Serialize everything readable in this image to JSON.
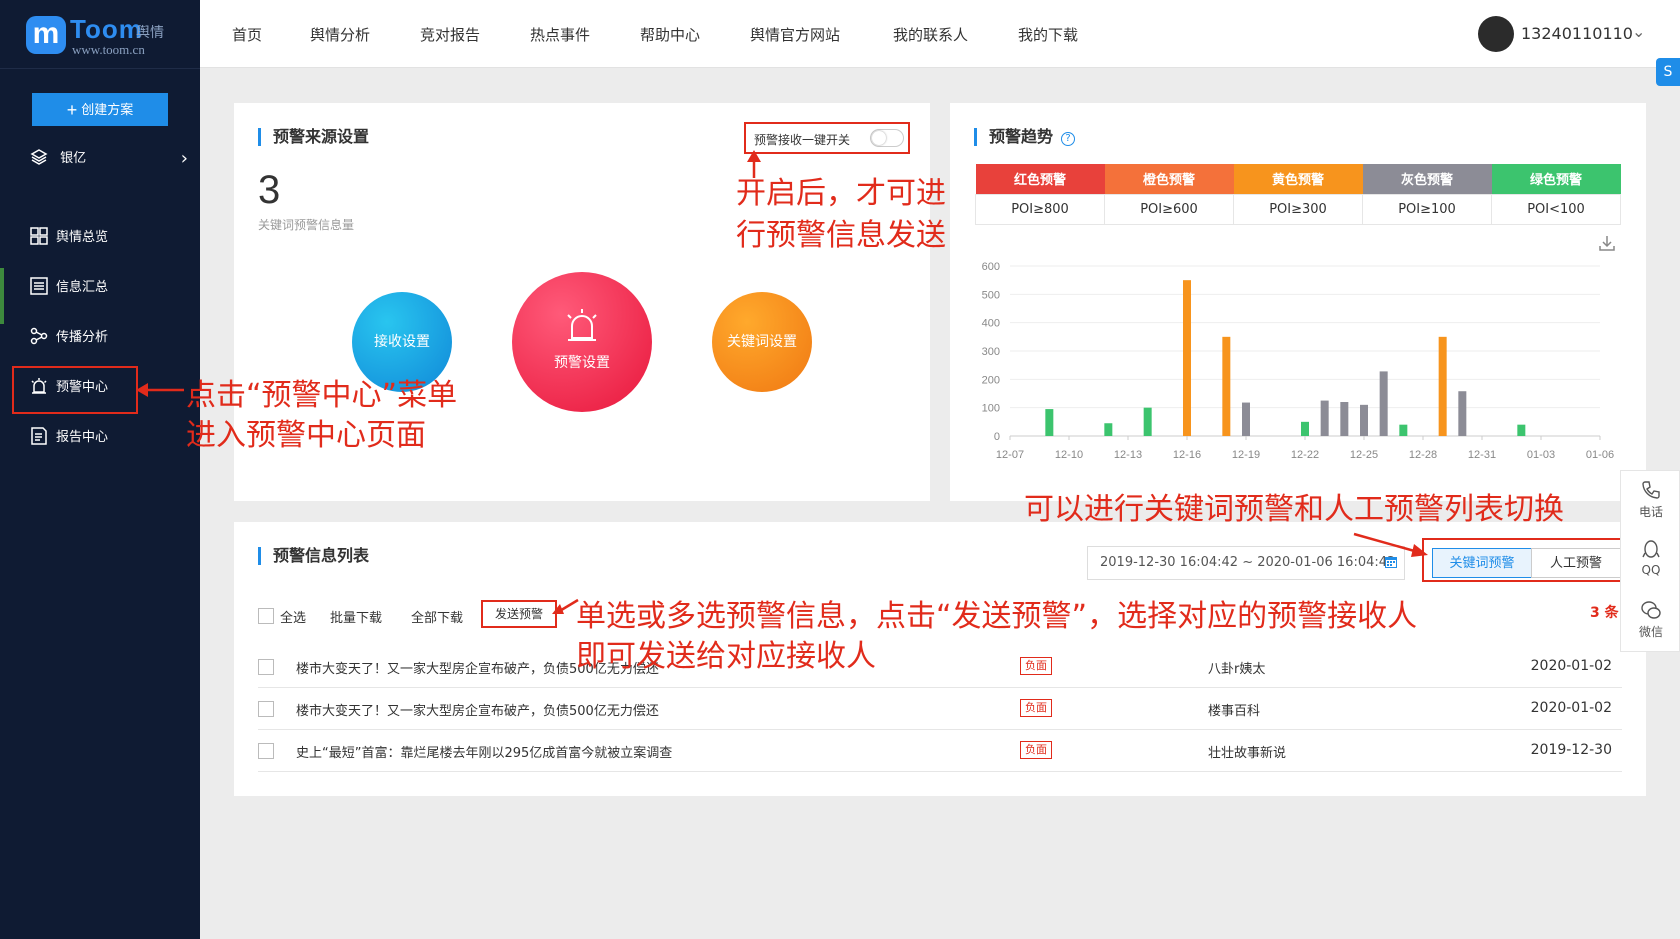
{
  "brand": {
    "name": "Toom",
    "sub": "舆情",
    "url": "www.toom.cn"
  },
  "sidebar": {
    "create_label": "创建方案",
    "org": "银亿",
    "items": [
      {
        "label": "舆情总览"
      },
      {
        "label": "信息汇总"
      },
      {
        "label": "传播分析"
      },
      {
        "label": "预警中心"
      },
      {
        "label": "报告中心"
      }
    ]
  },
  "topnav": {
    "items": [
      "首页",
      "舆情分析",
      "竞对报告",
      "热点事件",
      "帮助中心",
      "舆情官方网站",
      "我的联系人",
      "我的下载"
    ],
    "user_phone": "13240110110"
  },
  "source_card": {
    "title": "预警来源设置",
    "switch_label": "预警接收一键开关",
    "switch_on": false,
    "count": "3",
    "count_label": "关键词预警信息量",
    "btn_receive": "接收设置",
    "btn_alert": "预警设置",
    "btn_keyword": "关键词设置"
  },
  "trend_card": {
    "title": "预警趋势",
    "levels": [
      {
        "name": "红色预警",
        "rule": "POI≥800",
        "color": "#e8413b"
      },
      {
        "name": "橙色预警",
        "rule": "POI≥600",
        "color": "#f4713a"
      },
      {
        "name": "黄色预警",
        "rule": "POI≥300",
        "color": "#f7941d"
      },
      {
        "name": "灰色预警",
        "rule": "POI≥100",
        "color": "#8c8c96"
      },
      {
        "name": "绿色预警",
        "rule": "POI<100",
        "color": "#3cc46e"
      }
    ]
  },
  "chart_data": {
    "type": "bar",
    "ylim": [
      0,
      600
    ],
    "yticks": [
      0,
      100,
      200,
      300,
      400,
      500,
      600
    ],
    "xticks": [
      "12-07",
      "12-10",
      "12-13",
      "12-16",
      "12-19",
      "12-22",
      "12-25",
      "12-28",
      "12-31",
      "01-03",
      "01-06"
    ],
    "bars": [
      {
        "x": "12-09",
        "value": 95,
        "color": "#3cc46e"
      },
      {
        "x": "12-12",
        "value": 45,
        "color": "#3cc46e"
      },
      {
        "x": "12-14",
        "value": 100,
        "color": "#3cc46e"
      },
      {
        "x": "12-16",
        "value": 550,
        "color": "#f7941d"
      },
      {
        "x": "12-18",
        "value": 350,
        "color": "#f7941d"
      },
      {
        "x": "12-19",
        "value": 118,
        "color": "#8c8c96"
      },
      {
        "x": "12-22",
        "value": 50,
        "color": "#3cc46e"
      },
      {
        "x": "12-23",
        "value": 125,
        "color": "#8c8c96"
      },
      {
        "x": "12-24",
        "value": 120,
        "color": "#8c8c96"
      },
      {
        "x": "12-25",
        "value": 110,
        "color": "#8c8c96"
      },
      {
        "x": "12-26",
        "value": 228,
        "color": "#8c8c96"
      },
      {
        "x": "12-27",
        "value": 40,
        "color": "#3cc46e"
      },
      {
        "x": "12-29",
        "value": 350,
        "color": "#f7941d"
      },
      {
        "x": "12-30",
        "value": 158,
        "color": "#8c8c96"
      },
      {
        "x": "01-02",
        "value": 40,
        "color": "#3cc46e"
      }
    ]
  },
  "list_card": {
    "title": "预警信息列表",
    "date_range": "2019-12-30 16:04:42 ~ 2020-01-06 16:04:42",
    "tab_keyword": "关键词预警",
    "tab_manual": "人工预警",
    "count": "3 条",
    "toolbar": {
      "select_all": "全选",
      "batch_download": "批量下载",
      "all_download": "全部下载",
      "send": "发送预警"
    },
    "rows": [
      {
        "title": "楼市大变天了！又一家大型房企宣布破产，负债500亿无力偿还",
        "tag": "负面",
        "source": "八卦r姨太",
        "date": "2020-01-02"
      },
      {
        "title": "楼市大变天了！又一家大型房企宣布破产，负债500亿无力偿还",
        "tag": "负面",
        "source": "楼事百科",
        "date": "2020-01-02"
      },
      {
        "title": "史上“最短”首富：靠烂尾楼去年刚以295亿成首富今就被立案调查",
        "tag": "负面",
        "source": "壮壮故事新说",
        "date": "2019-12-30"
      }
    ]
  },
  "float_panel": {
    "phone": "电话",
    "qq": "QQ",
    "wechat": "微信"
  },
  "annotations": {
    "menu_1": "点击“预警中心”菜单",
    "menu_2": "进入预警中心页面",
    "switch_1": "开启后，才可进",
    "switch_2": "行预警信息发送",
    "toggle": "可以进行关键词预警和人工预警列表切换",
    "send_1": "单选或多选预警信息，点击“发送预警”，选择对应的预警接收人",
    "send_2": "即可发送给对应接收人"
  }
}
